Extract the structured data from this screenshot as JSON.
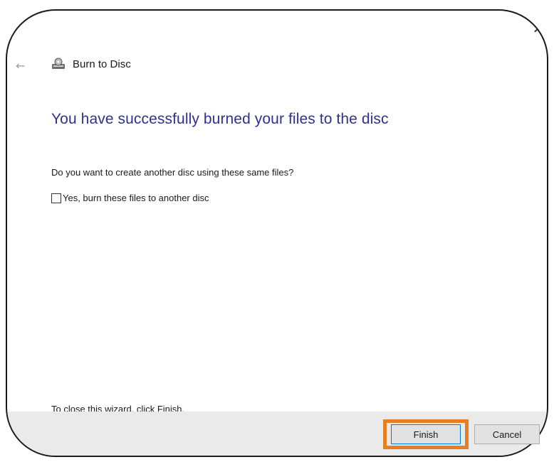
{
  "window": {
    "title": "Burn to Disc",
    "close_glyph": "✕",
    "back_glyph": "←"
  },
  "content": {
    "heading": "You have successfully burned your files to the disc",
    "question": "Do you want to create another disc using these same files?",
    "checkbox_label": "Yes, burn these files to another disc",
    "checkbox_checked": false,
    "close_hint": "To close this wizard, click Finish."
  },
  "footer": {
    "finish_label": "Finish",
    "cancel_label": "Cancel"
  },
  "icons": {
    "title_icon": "disc-burner-icon",
    "back": "back-arrow-icon",
    "close": "close-icon"
  },
  "colors": {
    "heading": "#2e3192",
    "highlight": "#e67e22",
    "footer_bg": "#eaeaea"
  }
}
